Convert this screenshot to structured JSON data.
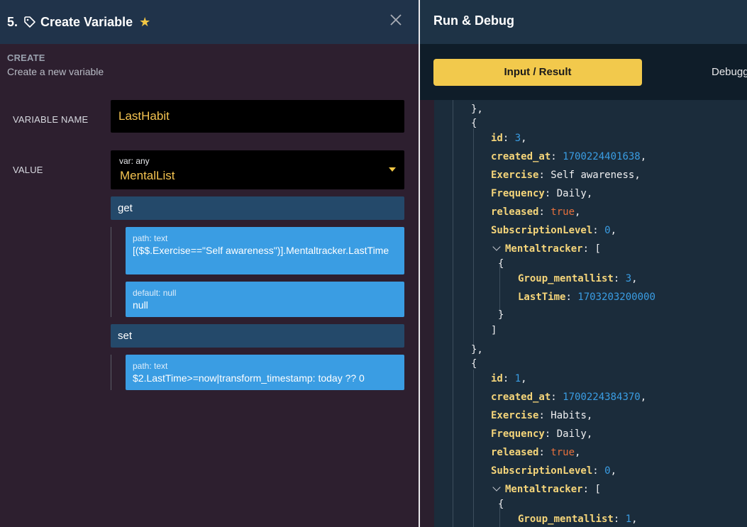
{
  "left_panel": {
    "step": "5.",
    "title": "Create Variable",
    "section_label": "CREATE",
    "section_subtitle": "Create a new variable",
    "variable_name_label": "VARIABLE NAME",
    "variable_name_value": "LastHabit",
    "value_label": "VALUE",
    "value_type": "var: any",
    "value_selected": "MentalList",
    "get": {
      "label": "get",
      "path_type": "path: text",
      "path_value": "[($$.Exercise==\"Self awareness\")].Mentaltracker.LastTime",
      "default_type": "default: null",
      "default_value": "null"
    },
    "set": {
      "label": "set",
      "path_type": "path: text",
      "path_value": "$2.LastTime>=now|transform_timestamp: today ?? 0"
    }
  },
  "right_panel": {
    "title": "Run & Debug",
    "tabs": [
      "Input / Result",
      "Debugger"
    ],
    "active_tab": "Input / Result",
    "code_lines": {
      "l1": "},",
      "l2": "{",
      "r1_id_key": "id",
      "r1_id_val": "3",
      "r1_created_key": "created_at",
      "r1_created_val": "1700224401638",
      "r1_exercise_key": "Exercise",
      "r1_exercise_val": "Self awareness",
      "r1_freq_key": "Frequency",
      "r1_freq_val": "Daily",
      "r1_released_key": "released",
      "r1_released_val": "true",
      "r1_sub_key": "SubscriptionLevel",
      "r1_sub_val": "0",
      "r1_mt_key": "Mentaltracker",
      "r1_mt_open": "[",
      "r1_obj_open": "{",
      "r1_group_key": "Group_mentallist",
      "r1_group_val": "3",
      "r1_last_key": "LastTime",
      "r1_last_val": "1703203200000",
      "r1_obj_close": "}",
      "r1_arr_close": "]",
      "l3": "},",
      "l4": "{",
      "r2_id_key": "id",
      "r2_id_val": "1",
      "r2_created_key": "created_at",
      "r2_created_val": "1700224384370",
      "r2_exercise_key": "Exercise",
      "r2_exercise_val": "Habits",
      "r2_freq_key": "Frequency",
      "r2_freq_val": "Daily",
      "r2_released_key": "released",
      "r2_released_val": "true",
      "r2_sub_key": "SubscriptionLevel",
      "r2_sub_val": "0",
      "r2_mt_key": "Mentaltracker",
      "r2_mt_open": "[",
      "r2_obj_open": "{",
      "r2_group_key": "Group_mentallist",
      "r2_group_val": "1"
    }
  },
  "colors": {
    "accent_yellow": "#f2c94c",
    "param_blue": "#3a9de3",
    "op_bar": "#24496a",
    "header_bg": "#20334a"
  }
}
